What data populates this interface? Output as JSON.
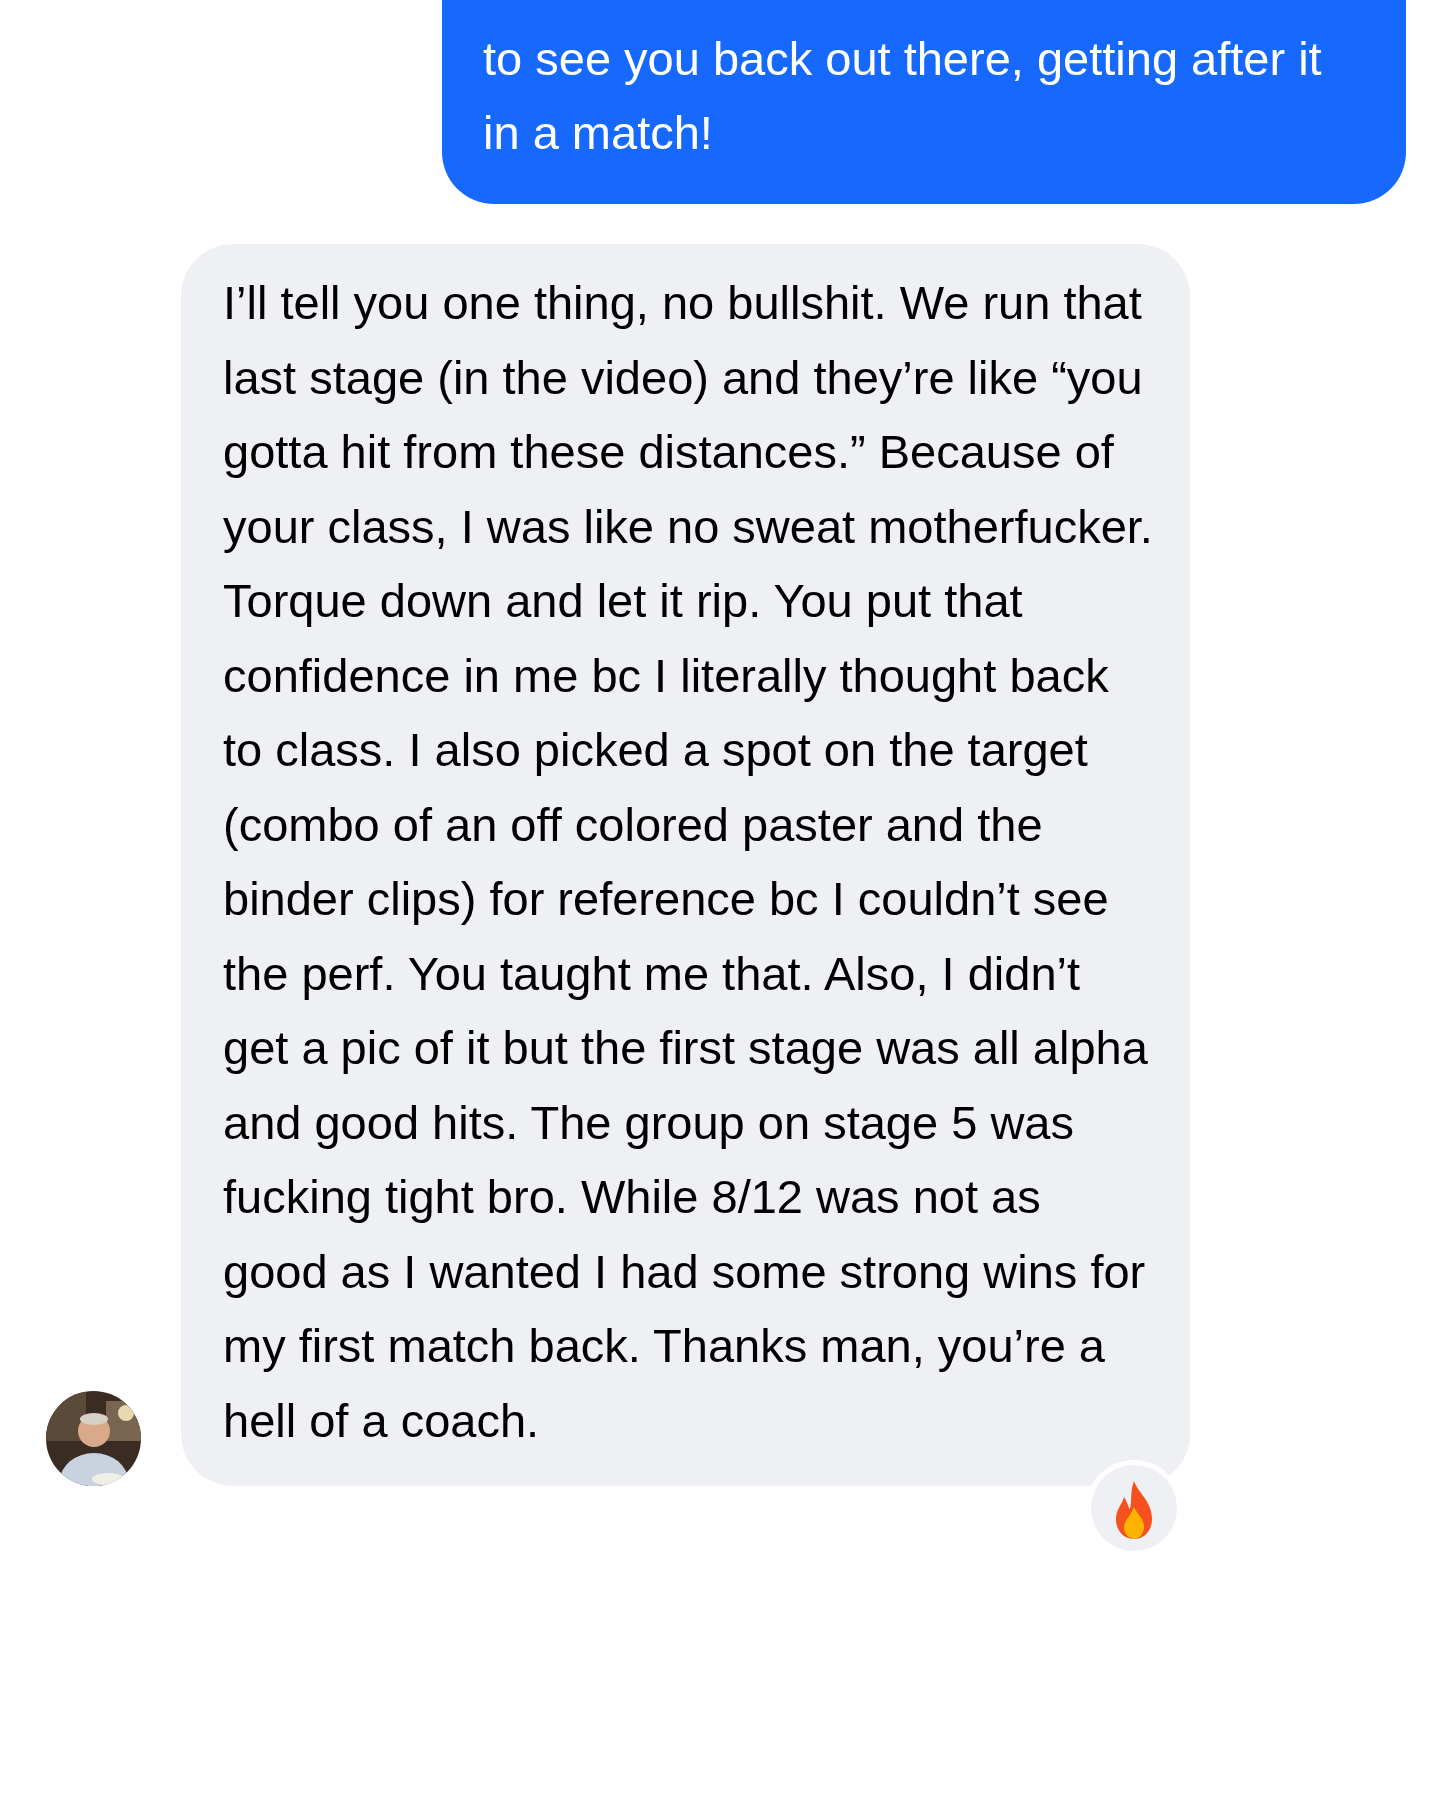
{
  "messages": [
    {
      "kind": "sent",
      "text": "to see you back out there, getting after it in a match!"
    },
    {
      "kind": "received",
      "text": "I’ll tell you one thing, no bullshit. We run that last stage (in the video) and they’re like “you gotta hit from these distances.” Because of your class, I was like no sweat motherfucker. Torque down and let it rip. You put that confidence in me bc I literally thought back to class. I also picked a spot on the target (combo of an off colored paster and the binder clips) for reference bc I couldn’t see the perf. You taught me that. Also, I didn’t get a pic of it but the first stage was all alpha and good hits. The group on stage 5 was fucking tight bro. While 8/12 was not as good as I wanted I had some strong wins for my first match back. Thanks man, you’re a hell of a coach."
    }
  ]
}
